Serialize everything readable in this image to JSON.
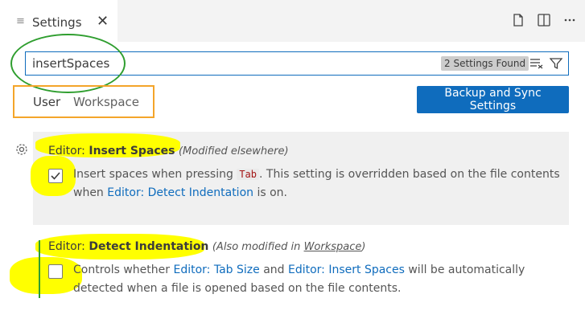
{
  "tab": {
    "title": "Settings",
    "close": "✕"
  },
  "search": {
    "value": "insertSpaces",
    "found": "2 Settings Found"
  },
  "scope": {
    "user": "User",
    "workspace": "Workspace"
  },
  "sync_button": "Backup and Sync Settings",
  "settings": [
    {
      "category": "Editor:",
      "name": "Insert Spaces",
      "note": "(Modified elsewhere)",
      "checked": true,
      "desc_1": "Insert spaces when pressing",
      "code": "Tab",
      "desc_2": ". This setting is overridden based on the file contents",
      "desc_3": "when",
      "link": "Editor: Detect Indentation",
      "desc_4": "is on."
    },
    {
      "category": "Editor:",
      "name": "Detect Indentation",
      "note_pre": "(Also modified in",
      "note_link": "Workspace",
      "note_post": ")",
      "checked": false,
      "desc_1": "Controls whether",
      "link_1": "Editor: Tab Size",
      "desc_2": "and",
      "link_2": "Editor: Insert Spaces",
      "desc_3": "will be automatically",
      "desc_4": "detected when a file is opened based on the file contents."
    }
  ],
  "annotations": {
    "ring_color": "#2f9e2f",
    "box_color": "#f4a52a",
    "highlight_color": "#ffff00"
  }
}
